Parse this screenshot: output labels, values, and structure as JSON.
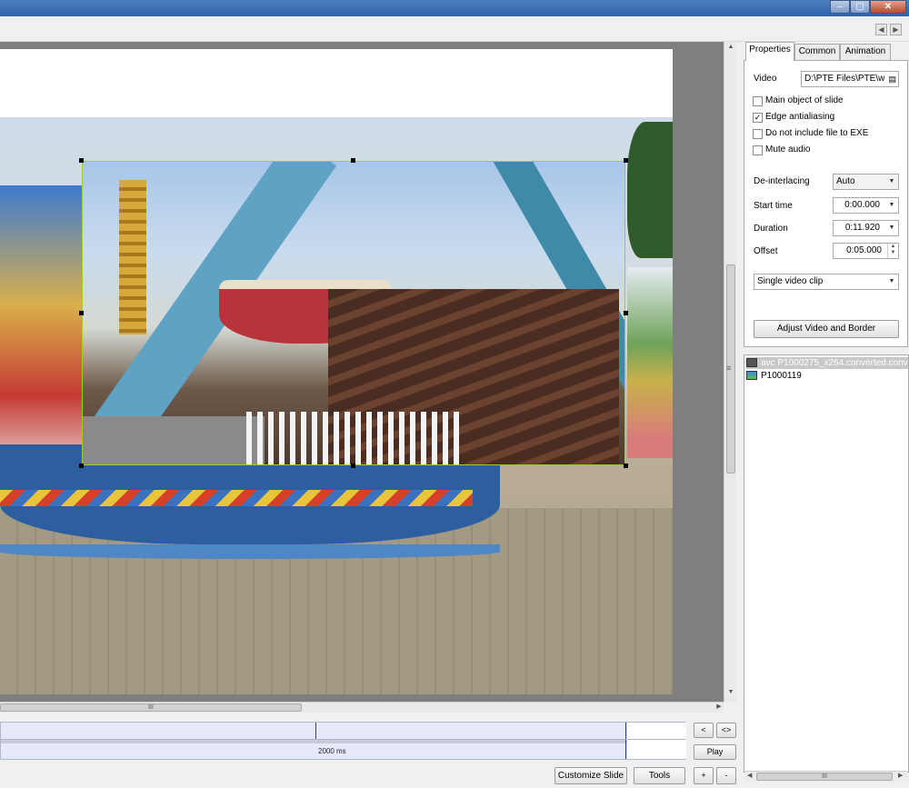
{
  "window": {
    "minimize_glyph": "–",
    "maximize_glyph": "▢",
    "close_glyph": "✕"
  },
  "toolbar": {
    "prev_glyph": "◀",
    "next_glyph": "▶"
  },
  "properties_panel": {
    "tabs": [
      "Properties",
      "Common",
      "Animation"
    ],
    "active_tab": "Properties",
    "video_label": "Video",
    "video_path": "D:\\PTE Files\\PTE\\w",
    "checkboxes": [
      {
        "label": "Main object of slide",
        "checked": false
      },
      {
        "label": "Edge antialiasing",
        "checked": true
      },
      {
        "label": "Do not include file to EXE",
        "checked": false
      },
      {
        "label": "Mute audio",
        "checked": false
      }
    ],
    "deinterlacing_label": "De-interlacing",
    "deinterlacing_value": "Auto",
    "start_time_label": "Start time",
    "start_time_value": "0:00.000",
    "duration_label": "Duration",
    "duration_value": "0:11.920",
    "offset_label": "Offset",
    "offset_value": "0:05.000",
    "clip_mode_value": "Single video clip",
    "adjust_button": "Adjust Video and Border"
  },
  "object_list": {
    "items": [
      {
        "label": "avc P1000275_x264.converted.conver",
        "type": "video",
        "selected": true
      },
      {
        "label": "P1000119",
        "type": "image",
        "selected": false
      }
    ]
  },
  "timeline": {
    "label": "2000 ms"
  },
  "bottom_buttons": {
    "prev": "<",
    "next_plus": "<>",
    "play": "Play",
    "customize_slide": "Customize Slide",
    "tools": "Tools",
    "plus": "+",
    "minus": "-"
  },
  "scroll_grip": "III",
  "splitter_glyph": "≡"
}
